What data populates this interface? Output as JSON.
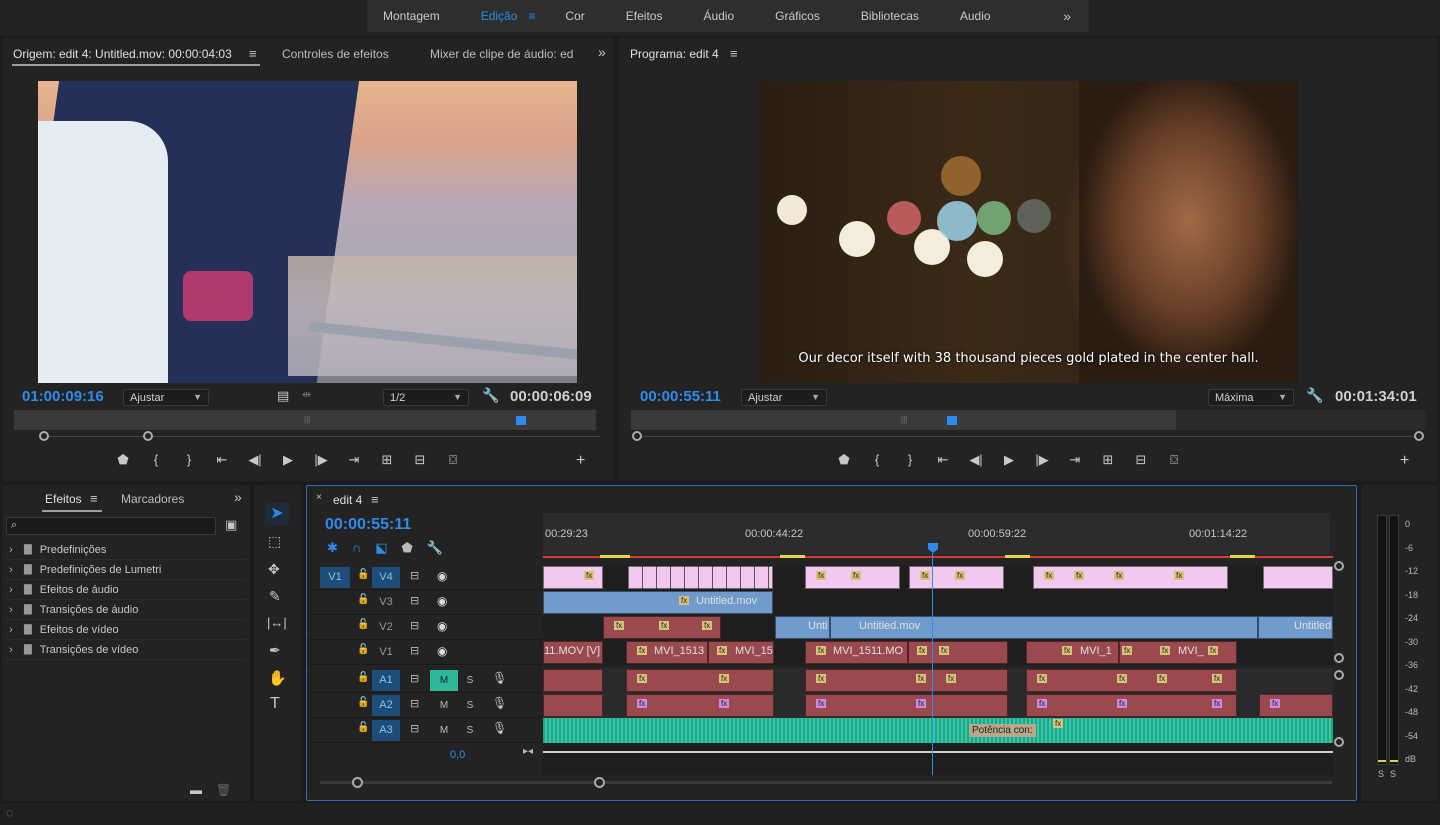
{
  "workspaces": {
    "tabs": [
      "Montagem",
      "Edição",
      "Cor",
      "Efeitos",
      "Áudio",
      "Gráficos",
      "Bibliotecas",
      "Audio"
    ],
    "active": "Edição",
    "menu_icon": "hamburger-icon",
    "more_icon": "double-chevron-right-icon"
  },
  "source_monitor": {
    "tabs": [
      "Origem: edit 4: Untitled.mov: 00:00:04:03",
      "Controles de efeitos",
      "Mixer de clipe de áudio: ed"
    ],
    "timecode_in": "01:00:09:16",
    "fit": "Ajustar",
    "resolution": "1/2",
    "duration": "00:00:06:09"
  },
  "program_monitor": {
    "title": "Programa: edit 4",
    "subtitle": "Our decor itself with 38 thousand pieces gold plated in the center hall.",
    "timecode": "00:00:55:11",
    "fit": "Ajustar",
    "quality": "Máxima",
    "duration": "00:01:34:01"
  },
  "effects_panel": {
    "tabs": [
      "Efeitos",
      "Marcadores"
    ],
    "items": [
      "Predefinições",
      "Predefinições de Lumetri",
      "Efeitos de áudio",
      "Transições de áudio",
      "Efeitos de vídeo",
      "Transições de vídeo"
    ]
  },
  "timeline": {
    "sequence_name": "edit 4",
    "timecode": "00:00:55:11",
    "ruler": [
      "00:29:23",
      "00:00:44:22",
      "00:00:59:22",
      "00:01:14:22"
    ],
    "video_tracks": [
      "V4",
      "V3",
      "V2",
      "V1"
    ],
    "source_patch_video": "V1",
    "audio_tracks": [
      "A1",
      "A2",
      "A3"
    ],
    "track_buttons": {
      "mute": "M",
      "solo": "S"
    },
    "master_value": "0,0",
    "clip_labels": {
      "v3": "Untitled.mov",
      "v2a": "Unti",
      "v2b": "Untitled.mov",
      "v2c": "Untitled",
      "v1a": "11.MOV [V]",
      "v1b": "MVI_1513",
      "v1c": "MVI_15",
      "v1d": "MVI_1511.MO",
      "v1e": "MVI_1",
      "v1f": "MVI_",
      "a3": "Potência con:"
    }
  },
  "meter": {
    "scale": [
      "0",
      "-6",
      "-12",
      "-18",
      "-24",
      "-30",
      "-36",
      "-42",
      "-48",
      "-54",
      "dB"
    ],
    "solo_labels": [
      "S",
      "S"
    ]
  },
  "colors": {
    "accent": "#2d8ceb",
    "video_clip_pink": "#f2c8f0",
    "video_clip_blue": "#6f9ccd",
    "video_clip_red": "#9a4a4e",
    "audio_clip_green": "#2fb99a"
  }
}
